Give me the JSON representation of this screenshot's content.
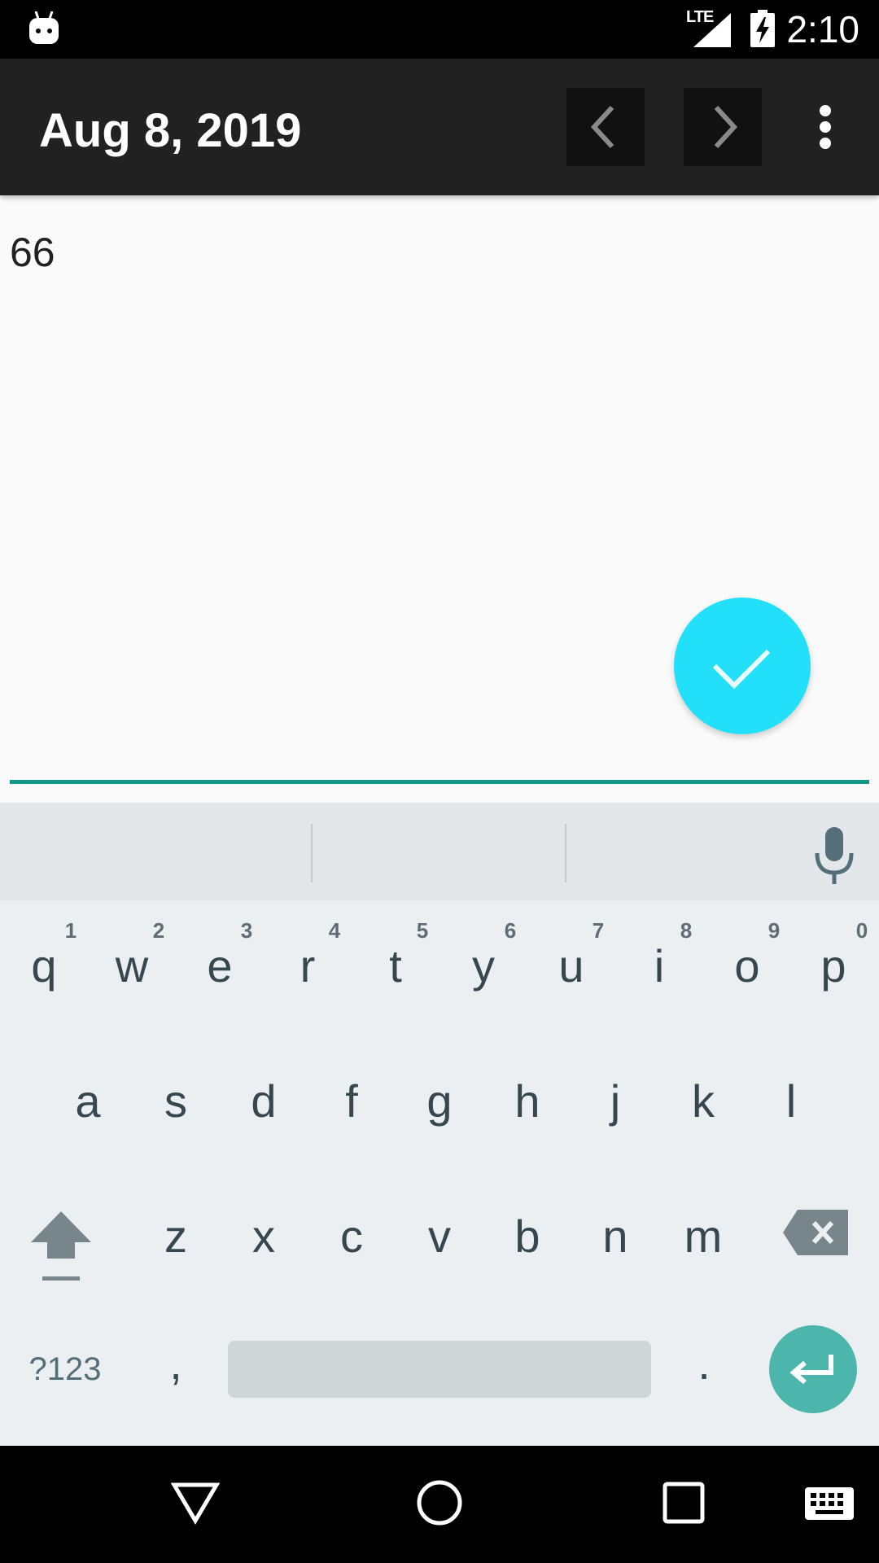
{
  "status_bar": {
    "time": "2:10",
    "network": "LTE",
    "icons": [
      "android-notification-icon",
      "signal-icon",
      "battery-charging-icon"
    ]
  },
  "toolbar": {
    "title": "Aug 8, 2019",
    "prev_icon": "chevron-left-icon",
    "next_icon": "chevron-right-icon",
    "menu_icon": "more-vert-icon"
  },
  "content": {
    "value": "66",
    "fab_icon": "check-icon"
  },
  "colors": {
    "fab": "#23e0fa",
    "accent_line": "#109688",
    "enter_key": "#4db6ac",
    "toolbar": "#212121"
  },
  "keyboard": {
    "row1": [
      {
        "key": "q",
        "hint": "1"
      },
      {
        "key": "w",
        "hint": "2"
      },
      {
        "key": "e",
        "hint": "3"
      },
      {
        "key": "r",
        "hint": "4"
      },
      {
        "key": "t",
        "hint": "5"
      },
      {
        "key": "y",
        "hint": "6"
      },
      {
        "key": "u",
        "hint": "7"
      },
      {
        "key": "i",
        "hint": "8"
      },
      {
        "key": "o",
        "hint": "9"
      },
      {
        "key": "p",
        "hint": "0"
      }
    ],
    "row2": [
      "a",
      "s",
      "d",
      "f",
      "g",
      "h",
      "j",
      "k",
      "l"
    ],
    "row3": [
      "z",
      "x",
      "c",
      "v",
      "b",
      "n",
      "m"
    ],
    "symbols_label": "?123",
    "comma": ",",
    "period": ".",
    "mic_icon": "microphone-icon",
    "shift_icon": "shift-icon",
    "backspace_icon": "backspace-icon",
    "enter_icon": "enter-icon"
  },
  "nav_bar": {
    "icons": [
      "back-icon",
      "home-icon",
      "recents-icon",
      "keyboard-switch-icon"
    ]
  }
}
